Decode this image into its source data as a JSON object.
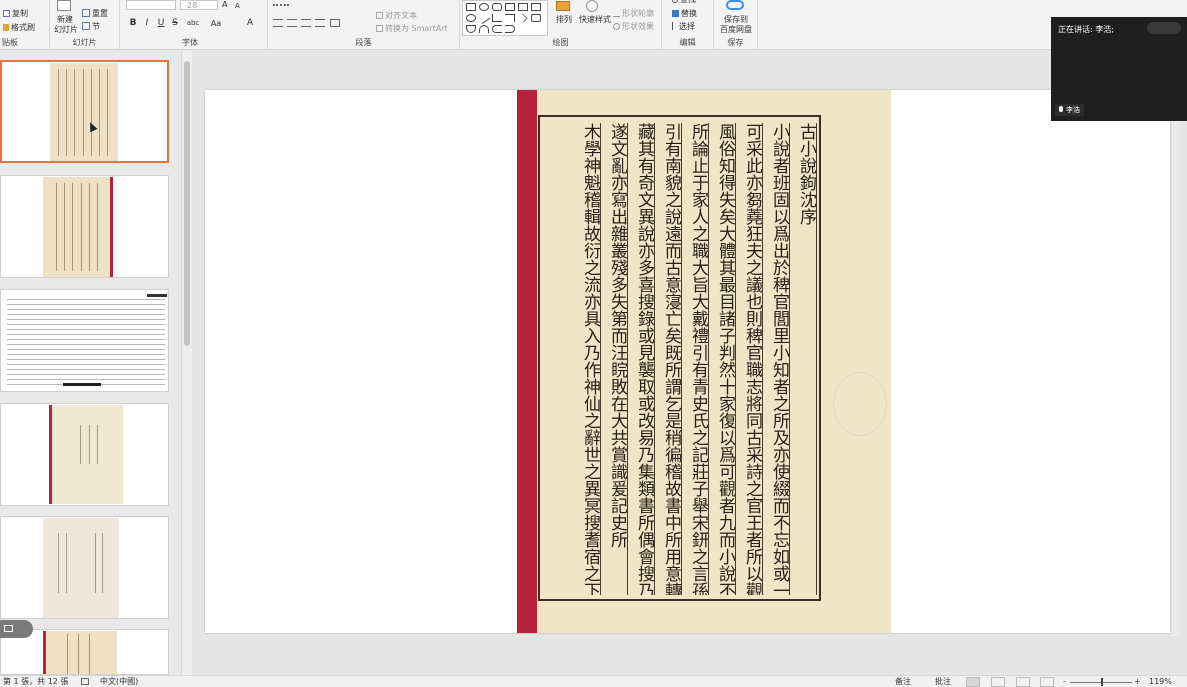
{
  "ribbon": {
    "clipboard": {
      "copy": "复制",
      "format_painter": "格式刷",
      "label": "贴板"
    },
    "slides": {
      "new_slide_line1": "新建",
      "new_slide_line2": "幻灯片",
      "reset": "重置",
      "section": "节",
      "label": "幻灯片"
    },
    "font": {
      "size": "28",
      "label": "字体",
      "bold": "B",
      "italic": "I",
      "underline": "U",
      "strike": "S",
      "spacing": "abc",
      "case": "Aa",
      "color": "A",
      "grow": "A",
      "shrink": "A"
    },
    "paragraph": {
      "align_text": "对齐文本",
      "convert_smartart": "转换为 SmartArt",
      "label": "段落"
    },
    "drawing": {
      "arrange": "排列",
      "quick_styles": "快速样式",
      "shape_outline": "形状轮廓",
      "shape_effects": "形状效果",
      "label": "绘图"
    },
    "editing": {
      "find": "查找",
      "replace": "替换",
      "select": "选择",
      "label": "编辑"
    },
    "save": {
      "line1": "保存到",
      "line2": "百度网盘",
      "label": "保存"
    }
  },
  "meeting": {
    "speaking": "正在讲话: 李浩;",
    "participant": "李浩"
  },
  "slide": {
    "columns": [
      "古小說鉤沈序",
      "小說者班固以爲出於稗官閭里小知者之所及亦使綴而不忘如或一言",
      "可采此亦芻蕘狂夫之議也則稗官職志將同古采詩之官王者所以觀",
      "風俗知得失矣大體其最目諸子判然十家復以爲可觀者九而小說不與",
      "所論止于家人之職大旨大戴禮引有青史氏之記莊子舉宋鈃之言孫卿",
      "引有南貌之說遠而古意寖亡矣既所謂乞是稍徧稽故書中所用意轉移",
      "藏其有奇文異說亦多喜搜錄或見襲取或改易乃集類書所偶會搜乃",
      "遂文亂亦寫出雜叢殘多失第而汪睆敗在大共賞識爰記史所",
      "木學神魁稽輯故衍之流亦具入乃作神仙之辭世之異冥搜耆宿之下來"
    ]
  },
  "status": {
    "slide_count": "第 1 張，共 12 張",
    "language": "中文(中國)",
    "notes": "备注",
    "comments": "批注",
    "zoom_minus": "-",
    "zoom_plus": "+",
    "zoom": "119%"
  }
}
